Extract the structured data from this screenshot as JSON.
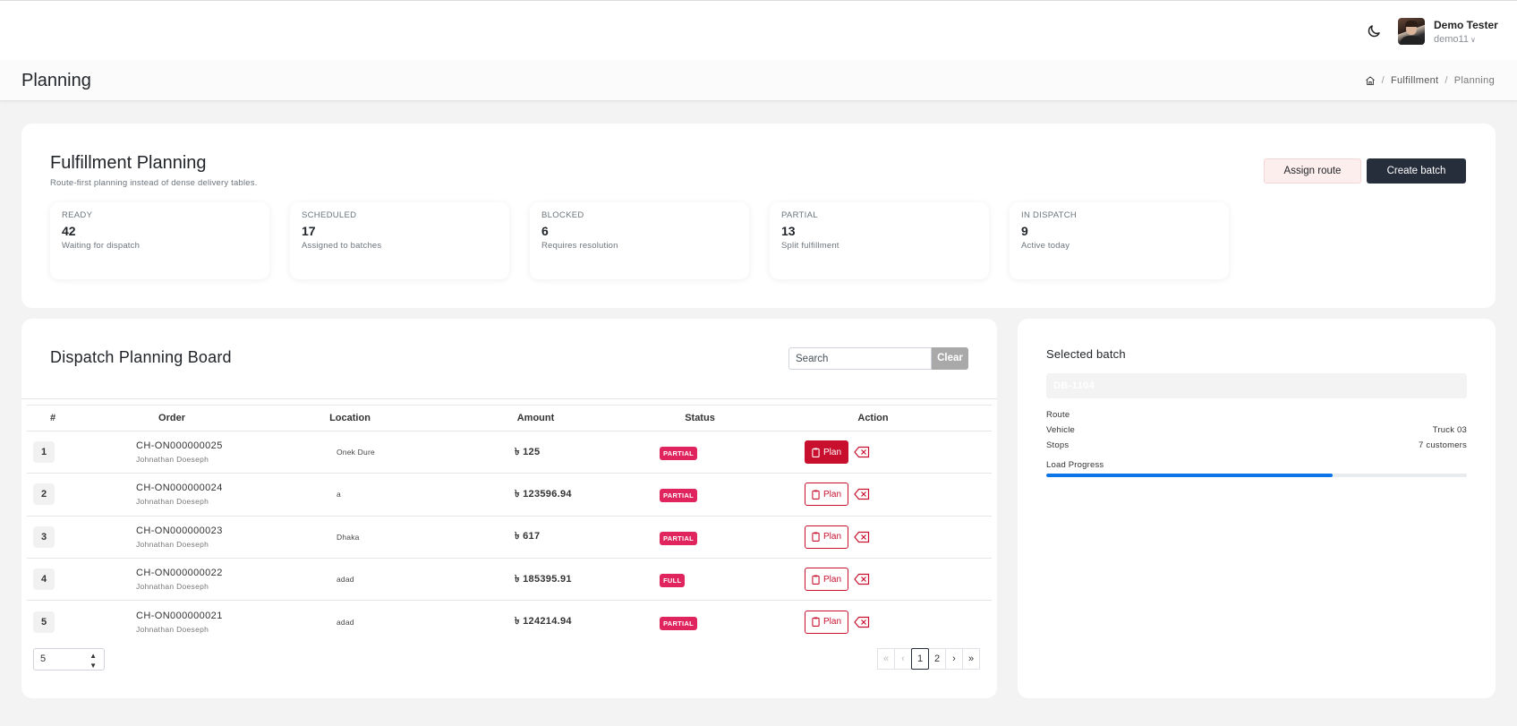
{
  "header": {
    "user_name": "Demo Tester",
    "user_handle": "demo11"
  },
  "subheader": {
    "title": "Planning",
    "breadcrumb": [
      "Fulfillment",
      "Planning"
    ]
  },
  "summary": {
    "title": "Fulfillment Planning",
    "subtitle": "Route-first planning instead of dense delivery tables.",
    "assign_label": "Assign route",
    "create_label": "Create batch",
    "stats": [
      {
        "label": "READY",
        "value": "42",
        "note": "Waiting for dispatch"
      },
      {
        "label": "SCHEDULED",
        "value": "17",
        "note": "Assigned to batches"
      },
      {
        "label": "BLOCKED",
        "value": "6",
        "note": "Requires resolution"
      },
      {
        "label": "PARTIAL",
        "value": "13",
        "note": "Split fulfillment"
      },
      {
        "label": "IN DISPATCH",
        "value": "9",
        "note": "Active today"
      }
    ]
  },
  "board": {
    "title": "Dispatch Planning Board",
    "search_placeholder": "Search",
    "clear_label": "Clear",
    "columns": [
      "#",
      "Order",
      "Location",
      "Amount",
      "Status",
      "Action"
    ],
    "plan_label": "Plan",
    "rows": [
      {
        "num": "1",
        "order": "CH-ON000000025",
        "customer": "Johnathan Doeseph",
        "location": "Onek Dure",
        "amount": "৳ 125",
        "status": "PARTIAL",
        "active": true
      },
      {
        "num": "2",
        "order": "CH-ON000000024",
        "customer": "Johnathan Doeseph",
        "location": "a",
        "amount": "৳ 123596.94",
        "status": "PARTIAL",
        "active": false
      },
      {
        "num": "3",
        "order": "CH-ON000000023",
        "customer": "Johnathan Doeseph",
        "location": "Dhaka",
        "amount": "৳ 617",
        "status": "PARTIAL",
        "active": false
      },
      {
        "num": "4",
        "order": "CH-ON000000022",
        "customer": "Johnathan Doeseph",
        "location": "adad",
        "amount": "৳ 185395.91",
        "status": "FULL",
        "active": false
      },
      {
        "num": "5",
        "order": "CH-ON000000021",
        "customer": "Johnathan Doeseph",
        "location": "adad",
        "amount": "৳ 124214.94",
        "status": "PARTIAL",
        "active": false
      }
    ],
    "page_size": "5",
    "pager": {
      "first": "«",
      "prev": "‹",
      "pages": [
        "1",
        "2"
      ],
      "current": "1",
      "next": "›",
      "last": "»"
    }
  },
  "batch": {
    "title": "Selected batch",
    "id": "DB-1104",
    "route_label": "Route",
    "route_value": "",
    "vehicle_label": "Vehicle",
    "vehicle_value": "Truck 03",
    "stops_label": "Stops",
    "stops_value": "7 customers",
    "progress_label": "Load Progress",
    "progress_fraction": 0.68
  },
  "colors": {
    "accent_dark": "#262d3b",
    "danger": "#c8102e",
    "badge": "#e0245e",
    "progress": "#0b74e6"
  },
  "icons": {
    "theme": "moon-icon",
    "home": "home-icon",
    "plan": "clipboard-icon",
    "remove": "backspace-x-icon"
  }
}
